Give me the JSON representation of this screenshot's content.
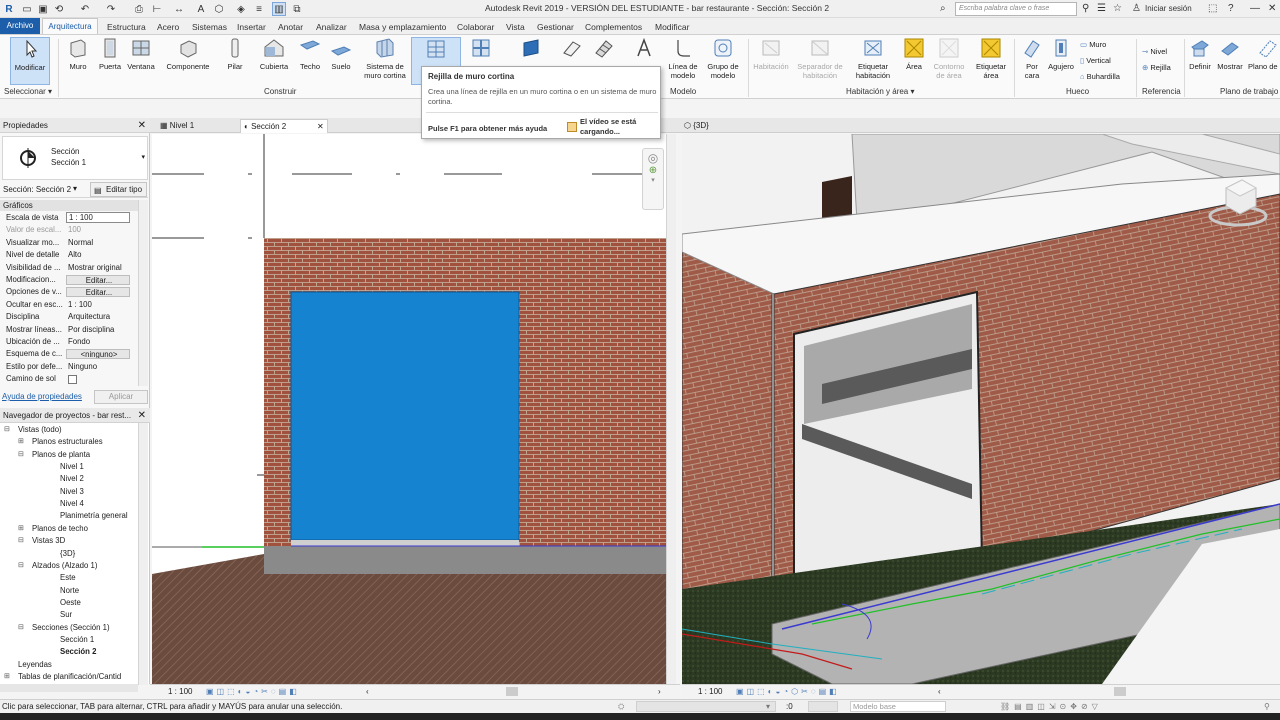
{
  "titlebar": {
    "title": "Autodesk Revit 2019 - VERSIÓN DEL ESTUDIANTE - bar restaurante - Sección: Sección 2",
    "search_placeholder": "Escriba palabra clave o frase",
    "signin": "Iniciar sesión"
  },
  "tabs": [
    "Archivo",
    "Arquitectura",
    "Estructura",
    "Acero",
    "Sistemas",
    "Insertar",
    "Anotar",
    "Analizar",
    "Masa y emplazamiento",
    "Colaborar",
    "Vista",
    "Gestionar",
    "Complementos",
    "Modificar"
  ],
  "ribbon": {
    "tools": {
      "modificar": "Modificar",
      "muro": "Muro",
      "puerta": "Puerta",
      "ventana": "Ventana",
      "componente": "Componente",
      "pilar": "Pilar",
      "cubierta": "Cubierta",
      "techo": "Techo",
      "suelo": "Suelo",
      "sistema_muro": "Sistema de muro cortina",
      "rejilla_muro": "Rejilla de muro cortina",
      "linea_modelo": "Línea de modelo",
      "grupo_modelo": "Grupo de modelo",
      "habitacion": "Habitación",
      "separador": "Separador de habitación",
      "etiquetar_hab": "Etiquetar habitación",
      "area": "Área",
      "contorno_area": "Contorno de área",
      "etiquetar_area": "Etiquetar área",
      "por_cara": "Por cara",
      "agujero": "Agujero",
      "muro_small": "Muro",
      "vertical": "Vertical",
      "buhardilla": "Buhardilla",
      "nivel": "Nivel",
      "rejilla": "Rejilla",
      "definir": "Definir",
      "mostrar": "Mostrar",
      "plano_ref": "Plano de referencia"
    },
    "groups": {
      "seleccionar": "Seleccionar ▾",
      "construir": "Construir",
      "modelo": "Modelo",
      "habitacion_area": "Habitación y área ▾",
      "hueco": "Hueco",
      "referencia": "Referencia",
      "plano_trabajo": "Plano de trabajo"
    }
  },
  "tooltip": {
    "title": "Rejilla de muro cortina",
    "description": "Crea una línea de rejilla en un muro cortina o en un sistema de muro cortina.",
    "help": "Pulse F1 para obtener más ayuda",
    "video": "El vídeo se está cargando..."
  },
  "properties": {
    "header": "Propiedades",
    "type_line1": "Sección",
    "type_line2": "Sección 1",
    "instance_selector": "Sección: Sección 2",
    "edit_type": "Editar tipo",
    "category": "Gráficos",
    "rows": [
      {
        "k": "Escala de vista",
        "v": "1 : 100"
      },
      {
        "k": "Valor de escal...",
        "v": "100"
      },
      {
        "k": "Visualizar mo...",
        "v": "Normal"
      },
      {
        "k": "Nivel de detalle",
        "v": "Alto"
      },
      {
        "k": "Visibilidad de ...",
        "v": "Mostrar original"
      },
      {
        "k": "Modificacion...",
        "v": "Editar..."
      },
      {
        "k": "Opciones de v...",
        "v": "Editar..."
      },
      {
        "k": "Ocultar en esc...",
        "v": "1 : 100"
      },
      {
        "k": "Disciplina",
        "v": "Arquitectura"
      },
      {
        "k": "Mostrar líneas...",
        "v": "Por disciplina"
      },
      {
        "k": "Ubicación de ...",
        "v": "Fondo"
      },
      {
        "k": "Esquema de c...",
        "v": "<ninguno>"
      },
      {
        "k": "Estilo por defe...",
        "v": "Ninguno"
      },
      {
        "k": "Camino de sol",
        "v": ""
      }
    ],
    "help_link": "Ayuda de propiedades",
    "apply": "Aplicar"
  },
  "browser": {
    "header": "Navegador de proyectos - bar rest...",
    "nodes": [
      {
        "label": "Vistas (todo)",
        "depth": 0,
        "tog": "−"
      },
      {
        "label": "Planos estructurales",
        "depth": 1,
        "tog": "+"
      },
      {
        "label": "Planos de planta",
        "depth": 1,
        "tog": "−"
      },
      {
        "label": "Nivel 1",
        "depth": 2,
        "tog": ""
      },
      {
        "label": "Nivel 2",
        "depth": 2,
        "tog": ""
      },
      {
        "label": "Nivel 3",
        "depth": 2,
        "tog": ""
      },
      {
        "label": "Nivel 4",
        "depth": 2,
        "tog": ""
      },
      {
        "label": "Planimetría general",
        "depth": 2,
        "tog": ""
      },
      {
        "label": "Planos de techo",
        "depth": 1,
        "tog": "+"
      },
      {
        "label": "Vistas 3D",
        "depth": 1,
        "tog": "−"
      },
      {
        "label": "{3D}",
        "depth": 2,
        "tog": ""
      },
      {
        "label": "Alzados (Alzado 1)",
        "depth": 1,
        "tog": "−"
      },
      {
        "label": "Este",
        "depth": 2,
        "tog": ""
      },
      {
        "label": "Norte",
        "depth": 2,
        "tog": ""
      },
      {
        "label": "Oeste",
        "depth": 2,
        "tog": ""
      },
      {
        "label": "Sur",
        "depth": 2,
        "tog": ""
      },
      {
        "label": "Secciones (Sección 1)",
        "depth": 1,
        "tog": "−"
      },
      {
        "label": "Sección 1",
        "depth": 2,
        "tog": ""
      },
      {
        "label": "Sección 2",
        "depth": 2,
        "tog": "",
        "bold": true
      },
      {
        "label": "Leyendas",
        "depth": 0,
        "tog": ""
      },
      {
        "label": "Tablas de planificación/Cantid",
        "depth": 0,
        "tog": "+"
      }
    ]
  },
  "views": {
    "tab1": "Nivel 1",
    "tab2": "Sección 2",
    "tab3": "{3D}",
    "scale_left": "1 : 100",
    "scale_right": "1 : 100"
  },
  "status": {
    "message": "Clic para seleccionar, TAB para alternar, CTRL para añadir y MAYÚS para anular una selección.",
    "coord": ":0",
    "model": "Modelo base"
  },
  "colors": {
    "accent": "#1c5ea9",
    "brick": "#a0523f",
    "glass": "#1683d0"
  }
}
